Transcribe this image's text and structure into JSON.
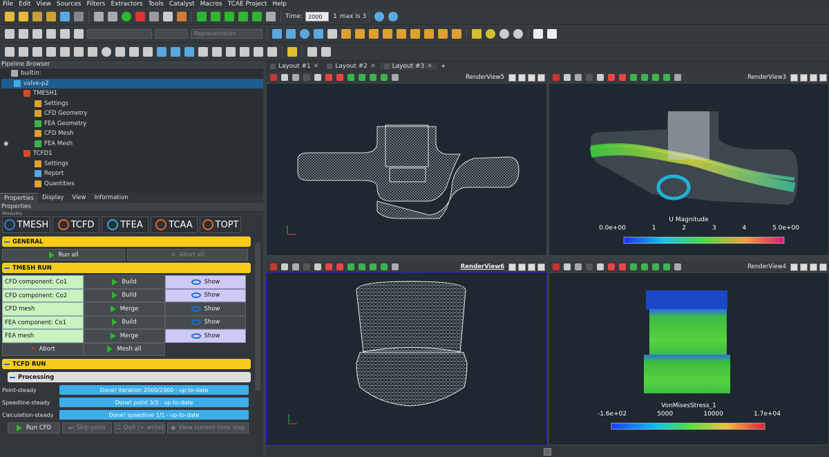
{
  "menu": [
    "File",
    "Edit",
    "View",
    "Sources",
    "Filters",
    "Extractors",
    "Tools",
    "Catalyst",
    "Macros",
    "TCAE Project",
    "Help"
  ],
  "time": {
    "label": "Time:",
    "value": "2000",
    "index": "1",
    "max": "max is 3"
  },
  "toolbar2": {
    "representation": "Representation"
  },
  "pipeline": {
    "title": "Pipeline Browser",
    "items": [
      "builtin:",
      "valve-p2",
      "TMESH1",
      "Settings",
      "CFD Geometry",
      "FEA Geometry",
      "CFD Mesh",
      "FEA Mesh",
      "TCFD1",
      "Settings",
      "Report",
      "Quantities"
    ]
  },
  "tabs": [
    "Properties",
    "Display",
    "View",
    "Information"
  ],
  "properties_title": "Properties",
  "modules_label": "Modules",
  "modules": [
    "TMESH",
    "TCFD",
    "TFEA",
    "TCAA",
    "TOPT"
  ],
  "general": {
    "title": "GENERAL",
    "run_all": "Run all",
    "abort_all": "Abort all"
  },
  "tmesh_run": {
    "title": "TMESH RUN",
    "rows": [
      {
        "label": "CFD component: Co1",
        "action": "Build",
        "show": "Show"
      },
      {
        "label": "CFD component: Co2",
        "action": "Build",
        "show": "Show"
      },
      {
        "label": "CFD mesh",
        "action": "Merge",
        "show": "Show"
      },
      {
        "label": "FEA component: Co1",
        "action": "Build",
        "show": "Show"
      },
      {
        "label": "FEA mesh",
        "action": "Merge",
        "show": "Show"
      }
    ],
    "abort": "Abort",
    "mesh_all": "Mesh all"
  },
  "tcfd_run": {
    "title": "TCFD RUN",
    "processing": "Processing",
    "rows": [
      {
        "label": "Point-steady",
        "status": "Done! iteration 2000/2000 - up-to-date"
      },
      {
        "label": "Speedline-steady",
        "status": "Done! point 3/3 - up-to-date"
      },
      {
        "label": "Calculation-steady",
        "status": "Done! speedline 1/1 - up-to-date"
      }
    ],
    "run_cfd": "Run CFD",
    "skip_point": "Skip point",
    "quit": "Quit (+ write)",
    "view_time": "View current time step"
  },
  "layout_tabs": [
    "Layout #1",
    "Layout #2",
    "Layout #3",
    "+"
  ],
  "views": {
    "v5": "RenderView5",
    "v3": "RenderView3",
    "v6": "RenderView6",
    "v4": "RenderView4"
  },
  "colorbar1": {
    "title": "U Magnitude",
    "ticks": [
      "0.0e+00",
      "1",
      "2",
      "3",
      "4",
      "5.0e+00"
    ]
  },
  "colorbar2": {
    "title": "VonMisesStress_1",
    "ticks": [
      "-1.6e+02",
      "5000",
      "10000",
      "1.7e+04"
    ]
  },
  "colors": {
    "accent": "#f7cb1b",
    "blue": "#3daee9",
    "green_cell": "#c9f2c0",
    "purple_cell": "#cfcaf5"
  }
}
